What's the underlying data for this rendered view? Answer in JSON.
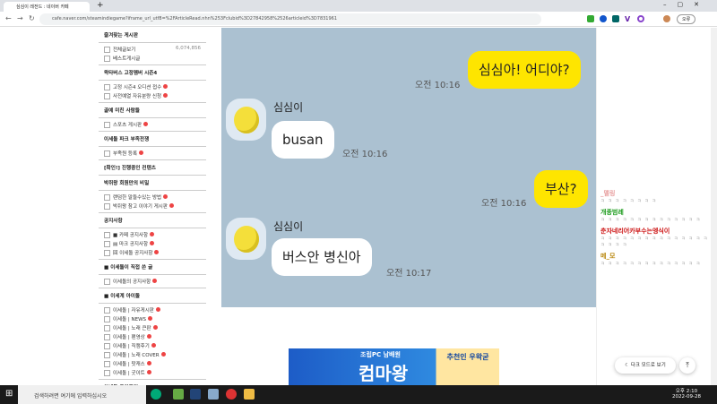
{
  "browser": {
    "tab_title": "심심이 레전드 : 네이버 카페",
    "url": "cafe.naver.com/steamindiegame?iframe_url_utf8=%2FArticleRead.nhn%253Fclubid%3D27842958%2526articleid%3D7831961",
    "profile_label": "오류"
  },
  "sidebar": {
    "favorites": "즐겨찾는 게시판",
    "all_posts": "전체글보기",
    "all_count": "6,074,856",
    "best": "베스트게시글",
    "groups": [
      {
        "title": "왁타버스 고정멤버 시즌4",
        "items": [
          "고정 시즌4 오디션 접수",
          "사전예열 자유분량 신청"
        ]
      },
      {
        "title": "골예 미친 사람들",
        "items": [
          "스포츠 게시판"
        ]
      },
      {
        "title": "이세돌 파크 부족전쟁",
        "items": [
          "부족원 등록"
        ]
      },
      {
        "title": "[확인!] 진행중인 컨텐츠",
        "items": []
      },
      {
        "title": "박쥐왕 회원만의 비밀",
        "items": [
          "랜덤한 말들수있는 방법",
          "박쥐왕 참고 이야기 게시판"
        ]
      },
      {
        "title": "공지사항",
        "items": [
          "■ 카페 공지사항",
          "▤ 마크 공지사항",
          "回 이세돌 공지사항"
        ]
      },
      {
        "title": "■ 이세돌이 직접 쓴 글",
        "items": [
          "이세돌의 공지사항"
        ]
      },
      {
        "title": "■ 이세계 아이돌",
        "items": [
          "이세돌 | 자유게시판",
          "이세돌 | NEWS",
          "이세돌 | 노래 큰판",
          "이세돌 | 팬영상",
          "이세돌 | 직캠후기",
          "이세돌 | 노래 COVER",
          "이세돌 | 팟캐스",
          "이세돌 | 굿이트"
        ]
      },
      {
        "title": "이세돌 도와주기",
        "items": []
      }
    ]
  },
  "chat": {
    "messages": [
      {
        "side": "right",
        "text": "심심아! 어디야?",
        "time": "오전 10:16"
      },
      {
        "side": "left",
        "name": "심심이",
        "text": "busan",
        "time": "오전 10:16"
      },
      {
        "side": "right",
        "text": "부산?",
        "time": "오전 10:16"
      },
      {
        "side": "left",
        "name": "심심이",
        "text": "버스안 병신아",
        "time": "오전 10:17"
      }
    ]
  },
  "right_panel": {
    "comments": [
      {
        "name": "_맬링",
        "text": "ㅋ ㅋ ㅋ ㅋ ㅋ ㅋ ㅋ ㅋ",
        "color": "#e8a0a0"
      },
      {
        "name": "개종범레",
        "text": "ㅋ ㅋ ㅋ ㅋ ㅋ ㅋ ㅋ ㅋ ㅋ ㅋ ㅋ ㅋ ㅋ ㅋ",
        "color": "#1a9a1a"
      },
      {
        "name": "춘자네리어카부수는엥식이",
        "text": "ㅋ ㅋ ㅋ ㅋ ㅋ ㅋ ㅋ ㅋ ㅋ ㅋ ㅋ ㅋ ㅋ ㅋ ㅋ ㅋ ㅋ ㅋ ㅋ ㅋ",
        "color": "#cc1111"
      },
      {
        "name": "메_모",
        "text": "ㅋ ㅋ ㅋ ㅋ ㅋ ㅋ ㅋ ㅋ ㅋ ㅋ ㅋ ㅋ ㅋ ㅋ",
        "color": "#b8860b"
      }
    ],
    "dark_mode": "다크 모드로 보기"
  },
  "banner": {
    "line1": "조립PC 남배원",
    "line2": "컴마왕",
    "badge": "추천인 우왁굳"
  },
  "taskbar": {
    "search_placeholder": "검색하려면 여기에 입력하십시오",
    "time": "오후 2:10",
    "date": "2022-09-28"
  }
}
